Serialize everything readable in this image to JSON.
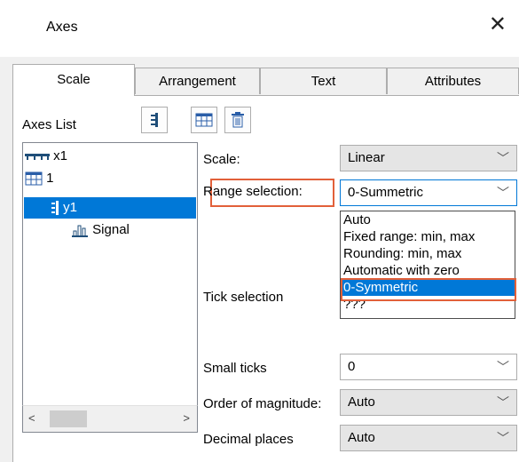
{
  "window": {
    "title": "Axes",
    "close_glyph": "✕"
  },
  "tabs": [
    {
      "label": "Scale",
      "active": true
    },
    {
      "label": "Arrangement",
      "active": false
    },
    {
      "label": "Text",
      "active": false
    },
    {
      "label": "Attributes",
      "active": false
    }
  ],
  "axes_list": {
    "label": "Axes List",
    "toolbar": [
      "add-axis-icon",
      "grid-icon",
      "delete-trash-icon"
    ],
    "tree": [
      {
        "label": "x1",
        "icon": "x-axis-icon"
      },
      {
        "label": "1",
        "icon": "table-grid-icon"
      },
      {
        "label": "y1",
        "icon": "y-axis-icon",
        "selected": true
      },
      {
        "label": "Signal",
        "icon": "signal-bars-icon"
      }
    ]
  },
  "fields": {
    "scale": {
      "label": "Scale:",
      "value": "Linear"
    },
    "range_selection": {
      "label": "Range selection:",
      "value": "0-Summetric",
      "options": [
        "Auto",
        "Fixed range: min, max",
        "Rounding: min, max",
        "Automatic with zero",
        "0-Symmetric",
        "???"
      ],
      "highlighted_option": "0-Symmetric"
    },
    "tick_selection": {
      "label": "Tick selection"
    },
    "small_ticks": {
      "label": "Small ticks",
      "value": "0"
    },
    "order_of_magnitude": {
      "label": "Order of magnitude:",
      "value": "Auto"
    },
    "decimal_places": {
      "label": "Decimal places",
      "value": "Auto"
    }
  },
  "colors": {
    "selection": "#0078d7",
    "highlight_box": "#e2603a"
  }
}
